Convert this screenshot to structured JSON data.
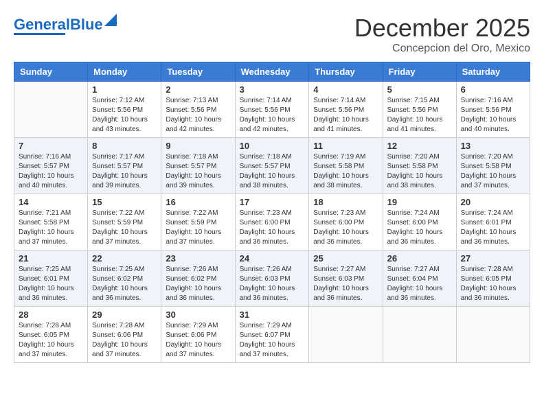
{
  "header": {
    "logo_general": "General",
    "logo_blue": "Blue",
    "month": "December 2025",
    "location": "Concepcion del Oro, Mexico"
  },
  "days_of_week": [
    "Sunday",
    "Monday",
    "Tuesday",
    "Wednesday",
    "Thursday",
    "Friday",
    "Saturday"
  ],
  "weeks": [
    [
      {
        "day": "",
        "info": ""
      },
      {
        "day": "1",
        "info": "Sunrise: 7:12 AM\nSunset: 5:56 PM\nDaylight: 10 hours\nand 43 minutes."
      },
      {
        "day": "2",
        "info": "Sunrise: 7:13 AM\nSunset: 5:56 PM\nDaylight: 10 hours\nand 42 minutes."
      },
      {
        "day": "3",
        "info": "Sunrise: 7:14 AM\nSunset: 5:56 PM\nDaylight: 10 hours\nand 42 minutes."
      },
      {
        "day": "4",
        "info": "Sunrise: 7:14 AM\nSunset: 5:56 PM\nDaylight: 10 hours\nand 41 minutes."
      },
      {
        "day": "5",
        "info": "Sunrise: 7:15 AM\nSunset: 5:56 PM\nDaylight: 10 hours\nand 41 minutes."
      },
      {
        "day": "6",
        "info": "Sunrise: 7:16 AM\nSunset: 5:56 PM\nDaylight: 10 hours\nand 40 minutes."
      }
    ],
    [
      {
        "day": "7",
        "info": "Sunrise: 7:16 AM\nSunset: 5:57 PM\nDaylight: 10 hours\nand 40 minutes."
      },
      {
        "day": "8",
        "info": "Sunrise: 7:17 AM\nSunset: 5:57 PM\nDaylight: 10 hours\nand 39 minutes."
      },
      {
        "day": "9",
        "info": "Sunrise: 7:18 AM\nSunset: 5:57 PM\nDaylight: 10 hours\nand 39 minutes."
      },
      {
        "day": "10",
        "info": "Sunrise: 7:18 AM\nSunset: 5:57 PM\nDaylight: 10 hours\nand 38 minutes."
      },
      {
        "day": "11",
        "info": "Sunrise: 7:19 AM\nSunset: 5:58 PM\nDaylight: 10 hours\nand 38 minutes."
      },
      {
        "day": "12",
        "info": "Sunrise: 7:20 AM\nSunset: 5:58 PM\nDaylight: 10 hours\nand 38 minutes."
      },
      {
        "day": "13",
        "info": "Sunrise: 7:20 AM\nSunset: 5:58 PM\nDaylight: 10 hours\nand 37 minutes."
      }
    ],
    [
      {
        "day": "14",
        "info": "Sunrise: 7:21 AM\nSunset: 5:58 PM\nDaylight: 10 hours\nand 37 minutes."
      },
      {
        "day": "15",
        "info": "Sunrise: 7:22 AM\nSunset: 5:59 PM\nDaylight: 10 hours\nand 37 minutes."
      },
      {
        "day": "16",
        "info": "Sunrise: 7:22 AM\nSunset: 5:59 PM\nDaylight: 10 hours\nand 37 minutes."
      },
      {
        "day": "17",
        "info": "Sunrise: 7:23 AM\nSunset: 6:00 PM\nDaylight: 10 hours\nand 36 minutes."
      },
      {
        "day": "18",
        "info": "Sunrise: 7:23 AM\nSunset: 6:00 PM\nDaylight: 10 hours\nand 36 minutes."
      },
      {
        "day": "19",
        "info": "Sunrise: 7:24 AM\nSunset: 6:00 PM\nDaylight: 10 hours\nand 36 minutes."
      },
      {
        "day": "20",
        "info": "Sunrise: 7:24 AM\nSunset: 6:01 PM\nDaylight: 10 hours\nand 36 minutes."
      }
    ],
    [
      {
        "day": "21",
        "info": "Sunrise: 7:25 AM\nSunset: 6:01 PM\nDaylight: 10 hours\nand 36 minutes."
      },
      {
        "day": "22",
        "info": "Sunrise: 7:25 AM\nSunset: 6:02 PM\nDaylight: 10 hours\nand 36 minutes."
      },
      {
        "day": "23",
        "info": "Sunrise: 7:26 AM\nSunset: 6:02 PM\nDaylight: 10 hours\nand 36 minutes."
      },
      {
        "day": "24",
        "info": "Sunrise: 7:26 AM\nSunset: 6:03 PM\nDaylight: 10 hours\nand 36 minutes."
      },
      {
        "day": "25",
        "info": "Sunrise: 7:27 AM\nSunset: 6:03 PM\nDaylight: 10 hours\nand 36 minutes."
      },
      {
        "day": "26",
        "info": "Sunrise: 7:27 AM\nSunset: 6:04 PM\nDaylight: 10 hours\nand 36 minutes."
      },
      {
        "day": "27",
        "info": "Sunrise: 7:28 AM\nSunset: 6:05 PM\nDaylight: 10 hours\nand 36 minutes."
      }
    ],
    [
      {
        "day": "28",
        "info": "Sunrise: 7:28 AM\nSunset: 6:05 PM\nDaylight: 10 hours\nand 37 minutes."
      },
      {
        "day": "29",
        "info": "Sunrise: 7:28 AM\nSunset: 6:06 PM\nDaylight: 10 hours\nand 37 minutes."
      },
      {
        "day": "30",
        "info": "Sunrise: 7:29 AM\nSunset: 6:06 PM\nDaylight: 10 hours\nand 37 minutes."
      },
      {
        "day": "31",
        "info": "Sunrise: 7:29 AM\nSunset: 6:07 PM\nDaylight: 10 hours\nand 37 minutes."
      },
      {
        "day": "",
        "info": ""
      },
      {
        "day": "",
        "info": ""
      },
      {
        "day": "",
        "info": ""
      }
    ]
  ]
}
